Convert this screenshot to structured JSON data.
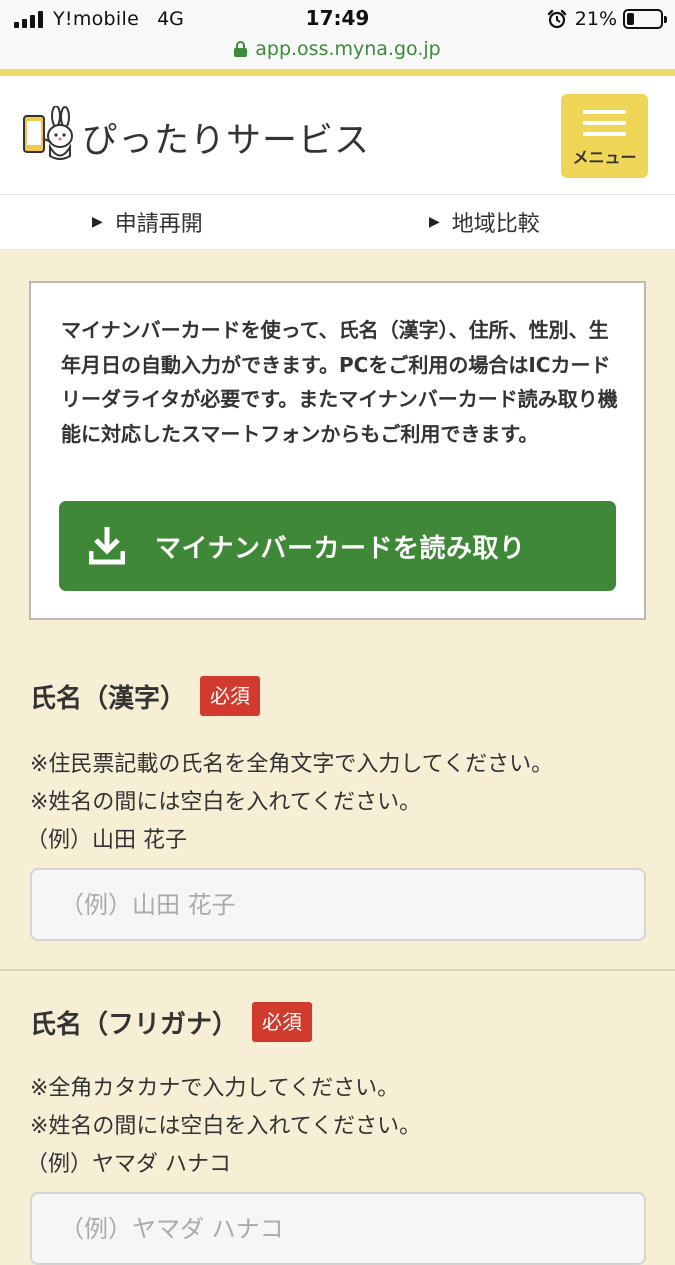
{
  "status_bar": {
    "carrier": "Y!mobile",
    "network": "4G",
    "time": "17:49",
    "battery_percent": "21%",
    "battery_level": 0.21,
    "icons": [
      "signal-icon",
      "alarm-icon",
      "battery-icon"
    ]
  },
  "browser": {
    "url": "app.oss.myna.go.jp",
    "secure": true
  },
  "header": {
    "title": "ぴったりサービス",
    "menu_label": "メニュー"
  },
  "subnav": {
    "items": [
      {
        "label": "申請再開"
      },
      {
        "label": "地域比較"
      }
    ]
  },
  "mynumber_card": {
    "description": "マイナンバーカードを使って、氏名（漢字）、住所、性別、生年月日の自動入力ができます。PCをご利用の場合はICカードリーダライタが必要です。またマイナンバーカード読み取り機能に対応したスマートフォンからもご利用できます。",
    "button_label": "マイナンバーカードを読み取り"
  },
  "form": {
    "name_kanji": {
      "label": "氏名（漢字）",
      "required_badge": "必須",
      "help": [
        "※住民票記載の氏名を全角文字で入力してください。",
        "※姓名の間には空白を入れてください。",
        "（例）山田 花子"
      ],
      "placeholder": "（例）山田 花子",
      "value": ""
    },
    "name_kana": {
      "label": "氏名（フリガナ）",
      "required_badge": "必須",
      "help": [
        "※全角カタカナで入力してください。",
        "※姓名の間には空白を入れてください。",
        "（例）ヤマダ ハナコ"
      ],
      "placeholder": "（例）ヤマダ ハナコ",
      "value": ""
    }
  },
  "colors": {
    "page_background": "#f6efd5",
    "accent_yellow": "#efd656",
    "primary_green": "#3f8837",
    "required_red": "#d13b2e",
    "url_green": "#3d8a3a"
  }
}
